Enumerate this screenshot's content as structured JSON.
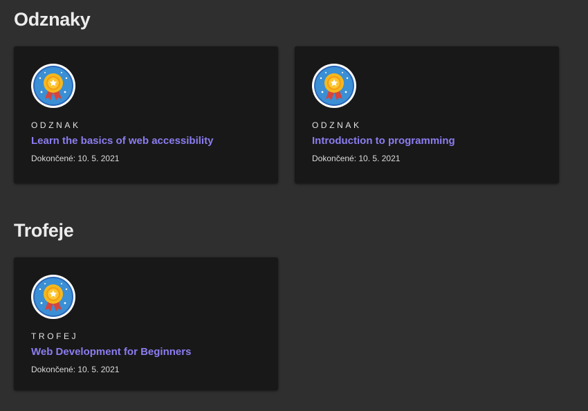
{
  "badges_section": {
    "title": "Odznaky",
    "cards": [
      {
        "type": "ODZNAK",
        "title": "Learn the basics of web accessibility",
        "date_label": "Dokončené: 10. 5. 2021",
        "icon": "award-medal-icon"
      },
      {
        "type": "ODZNAK",
        "title": "Introduction to programming",
        "date_label": "Dokončené: 10. 5. 2021",
        "icon": "award-medal-icon"
      }
    ]
  },
  "trophies_section": {
    "title": "Trofeje",
    "cards": [
      {
        "type": "TROFEJ",
        "title": "Web Development for Beginners",
        "date_label": "Dokončené: 10. 5. 2021",
        "icon": "award-medal-icon"
      }
    ]
  },
  "colors": {
    "background": "#2f2f2f",
    "card_background": "#181818",
    "link": "#8b7df0",
    "medal_blue": "#3b8fd4",
    "medal_gold": "#f5b81c",
    "ribbon_red": "#d8433a"
  }
}
